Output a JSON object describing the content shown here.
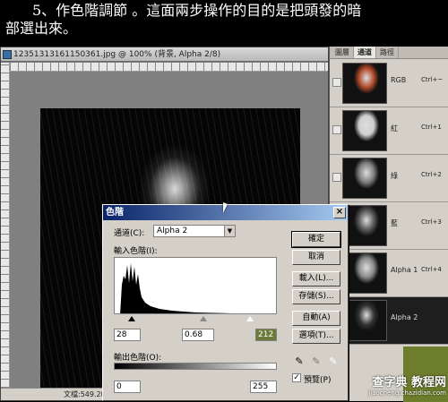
{
  "caption": {
    "line1": "5、作色階調節 。這面兩步操作的目的是把頭發的暗",
    "line2": "部選出來。"
  },
  "document": {
    "title": "12351313161150361.jpg @ 100% (背景, Alpha 2/8)",
    "status": "文檔:549.2K"
  },
  "panel": {
    "tabs": [
      "圖層",
      "通道",
      "路徑"
    ],
    "channels": [
      {
        "name": "RGB",
        "shortcut": "Ctrl+~",
        "thumb": "#b04a2a"
      },
      {
        "name": "紅",
        "shortcut": "Ctrl+1",
        "thumb": "#cfcfcf"
      },
      {
        "name": "綠",
        "shortcut": "Ctrl+2",
        "thumb": "#7e7e7e"
      },
      {
        "name": "藍",
        "shortcut": "Ctrl+3",
        "thumb": "#5a5a5a"
      },
      {
        "name": "Alpha 1",
        "shortcut": "Ctrl+4",
        "thumb": "#8a8a8a"
      },
      {
        "name": "Alpha 2",
        "shortcut": "",
        "thumb": "#333333"
      }
    ]
  },
  "levels_dialog": {
    "title": "色階",
    "channel_label": "通道(C):",
    "channel_value": "Alpha 2",
    "input_label": "輸入色階(I):",
    "input_black": "28",
    "input_gamma": "0.68",
    "input_white": "212",
    "output_label": "輸出色階(O):",
    "output_black": "0",
    "output_white": "255",
    "buttons": {
      "ok": "確定",
      "cancel": "取消",
      "load": "載入(L)...",
      "save": "存儲(S)...",
      "auto": "自動(A)",
      "options": "選項(T)..."
    },
    "preview_label": "預覽(P)",
    "preview_checked": true,
    "input_slider": {
      "black": 28,
      "gamma": 0.68,
      "white": 212
    }
  },
  "watermark": {
    "main": "查字典 教程网",
    "sub": "jiaocheng.chazidian.com"
  }
}
